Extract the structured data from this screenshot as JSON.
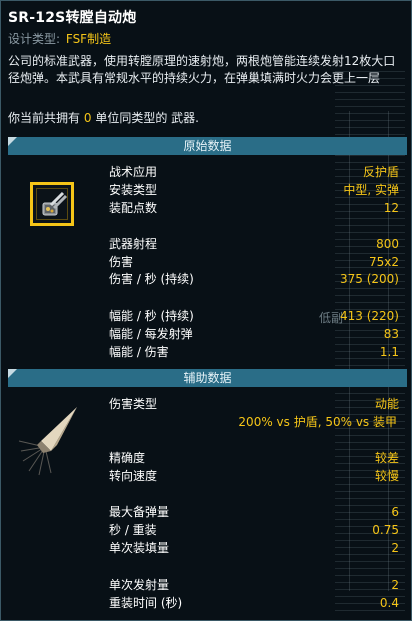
{
  "weapon": {
    "name": "SR-12S转膛自动炮",
    "design_type_label": "设计类型:",
    "manufacturer": "FSF制造",
    "description": "公司的标准武器，使用转膛原理的速射炮，两根炮管能连续发射12枚大口径炮弹。本武具有常规水平的持续火力，在弹巢填满时火力会更上一层",
    "owned_prefix": "你当前共拥有",
    "owned_count": "0",
    "owned_suffix": "单位同类型的 武器."
  },
  "primary": {
    "header": "原始数据",
    "icon": "rotary-cannon-icon",
    "rows": [
      {
        "label": "战术应用",
        "value": "反护盾"
      },
      {
        "label": "安装类型",
        "value": "中型, 实弹"
      },
      {
        "label": "装配点数",
        "value": "12"
      },
      {
        "label": "武器射程",
        "value": "800"
      },
      {
        "label": "伤害",
        "value": "75x2"
      },
      {
        "label": "伤害 / 秒 (持续)",
        "value": "375 (200)"
      },
      {
        "label": "幅能 / 秒 (持续)",
        "value": "413 (220)"
      },
      {
        "label": "幅能 / 每发射弹",
        "value": "83"
      },
      {
        "label": "幅能 / 伤害",
        "value": "1.1"
      }
    ],
    "ghost_text": "低副"
  },
  "auxiliary": {
    "header": "辅助数据",
    "icon": "kinetic-wedge-icon",
    "damage_type_label": "伤害类型",
    "damage_type_value": "动能",
    "damage_mod": "200% vs 护盾, 50% vs 装甲",
    "rows": [
      {
        "label": "精确度",
        "value": "较差"
      },
      {
        "label": "转向速度",
        "value": "较慢"
      },
      {
        "label": "最大备弹量",
        "value": "6"
      },
      {
        "label": "秒 / 重装",
        "value": "0.75"
      },
      {
        "label": "单次装填量",
        "value": "2"
      },
      {
        "label": "单次发射量",
        "value": "2"
      },
      {
        "label": "重装时间 (秒)",
        "value": "0.4"
      }
    ]
  },
  "colors": {
    "accent": "#f5c518",
    "header_bg": "#2a6d87",
    "text": "#e9eef2",
    "muted": "#8b9aa3",
    "background": "#081016"
  }
}
